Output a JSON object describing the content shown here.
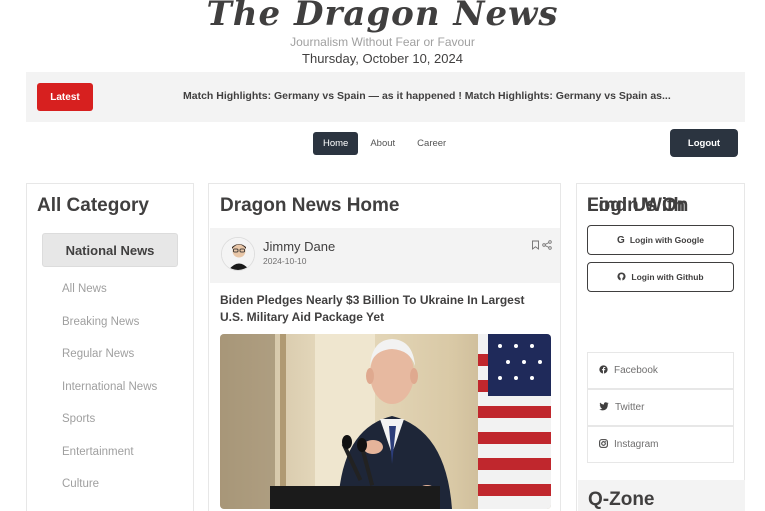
{
  "header": {
    "logo": "The Dragon News",
    "tagline": "Journalism Without Fear or Favour",
    "date": "Thursday, October 10, 2024"
  },
  "ticker": {
    "latest_label": "Latest",
    "text": "Match Highlights: Germany vs Spain — as it happened ! Match Highlights: Germany vs Spain as..."
  },
  "nav": {
    "home": "Home",
    "about": "About",
    "career": "Career",
    "logout": "Logout"
  },
  "left": {
    "title": "All Category",
    "active_category": "National News",
    "categories": [
      "All News",
      "Breaking News",
      "Regular News",
      "International News",
      "Sports",
      "Entertainment",
      "Culture"
    ]
  },
  "center": {
    "title": "Dragon News Home",
    "author_name": "Jimmy Dane",
    "author_date": "2024-10-10",
    "post_title": "Biden Pledges Nearly $3 Billion To Ukraine In Largest U.S. Military Aid Package Yet"
  },
  "right": {
    "login_title": "Login With",
    "google": "Login with Google",
    "github": "Login with Github",
    "find_title": "Find Us On",
    "facebook": "Facebook",
    "twitter": "Twitter",
    "instagram": "Instagram",
    "qzone_title": "Q-Zone"
  },
  "colors": {
    "accent_red": "#d7201f",
    "dark": "#2b3440",
    "text": "#403f3f",
    "muted": "#9f9f9f",
    "panel_bg": "#f3f3f3"
  }
}
